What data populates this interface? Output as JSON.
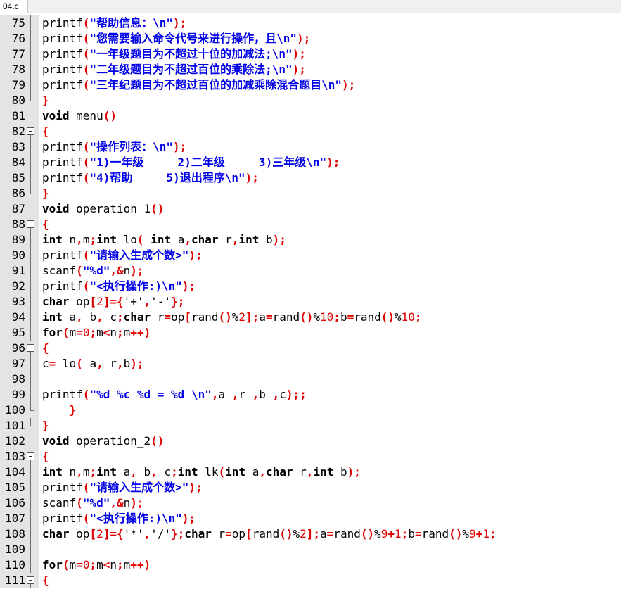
{
  "tab": {
    "label": "04.c"
  },
  "colors": {
    "keyword": "#000000",
    "string": "#0000e8",
    "operator": "#e00000",
    "number": "#e00000",
    "gutter": "#e4e4e4"
  },
  "lines": [
    {
      "n": "75",
      "fold": "line",
      "tokens": [
        [
          "plain",
          "printf"
        ],
        [
          "op",
          "("
        ],
        [
          "str",
          "\"帮助信息：\\n\""
        ],
        [
          "op",
          ");"
        ]
      ]
    },
    {
      "n": "76",
      "fold": "line",
      "tokens": [
        [
          "plain",
          "printf"
        ],
        [
          "op",
          "("
        ],
        [
          "str",
          "\"您需要输入命令代号来进行操作，且\\n\""
        ],
        [
          "op",
          ");"
        ]
      ]
    },
    {
      "n": "77",
      "fold": "line",
      "tokens": [
        [
          "plain",
          "printf"
        ],
        [
          "op",
          "("
        ],
        [
          "str",
          "\"一年级题目为不超过十位的加减法;\\n\""
        ],
        [
          "op",
          ");"
        ]
      ]
    },
    {
      "n": "78",
      "fold": "line",
      "tokens": [
        [
          "plain",
          "printf"
        ],
        [
          "op",
          "("
        ],
        [
          "str",
          "\"二年级题目为不超过百位的乘除法;\\n\""
        ],
        [
          "op",
          ");"
        ]
      ]
    },
    {
      "n": "79",
      "fold": "line",
      "tokens": [
        [
          "plain",
          "printf"
        ],
        [
          "op",
          "("
        ],
        [
          "str",
          "\"三年纪题目为不超过百位的加减乘除混合题目\\n\""
        ],
        [
          "op",
          ");"
        ]
      ]
    },
    {
      "n": "80",
      "fold": "end",
      "tokens": [
        [
          "op",
          "}"
        ]
      ]
    },
    {
      "n": "81",
      "fold": "none",
      "tokens": [
        [
          "kw",
          "void"
        ],
        [
          "plain",
          " menu"
        ],
        [
          "op",
          "()"
        ]
      ]
    },
    {
      "n": "82",
      "fold": "box",
      "tokens": [
        [
          "op",
          "{"
        ]
      ]
    },
    {
      "n": "83",
      "fold": "line",
      "tokens": [
        [
          "plain",
          "printf"
        ],
        [
          "op",
          "("
        ],
        [
          "str",
          "\"操作列表：\\n\""
        ],
        [
          "op",
          ");"
        ]
      ]
    },
    {
      "n": "84",
      "fold": "line",
      "tokens": [
        [
          "plain",
          "printf"
        ],
        [
          "op",
          "("
        ],
        [
          "str",
          "\"1)一年级     2)二年级     3)三年级\\n\""
        ],
        [
          "op",
          ");"
        ]
      ]
    },
    {
      "n": "85",
      "fold": "line",
      "tokens": [
        [
          "plain",
          "printf"
        ],
        [
          "op",
          "("
        ],
        [
          "str",
          "\"4)帮助     5)退出程序\\n\""
        ],
        [
          "op",
          ");"
        ]
      ]
    },
    {
      "n": "86",
      "fold": "end",
      "tokens": [
        [
          "op",
          "}"
        ]
      ]
    },
    {
      "n": "87",
      "fold": "none",
      "tokens": [
        [
          "kw",
          "void"
        ],
        [
          "plain",
          " operation_1"
        ],
        [
          "op",
          "()"
        ]
      ]
    },
    {
      "n": "88",
      "fold": "box",
      "tokens": [
        [
          "op",
          "{"
        ]
      ]
    },
    {
      "n": "89",
      "fold": "line",
      "tokens": [
        [
          "kw",
          "int"
        ],
        [
          "plain",
          " n"
        ],
        [
          "op",
          ","
        ],
        [
          "plain",
          "m"
        ],
        [
          "op",
          ";"
        ],
        [
          "kw",
          "int"
        ],
        [
          "plain",
          " lo"
        ],
        [
          "op",
          "("
        ],
        [
          "plain",
          " "
        ],
        [
          "kw",
          "int"
        ],
        [
          "plain",
          " a"
        ],
        [
          "op",
          ","
        ],
        [
          "kw",
          "char"
        ],
        [
          "plain",
          " r"
        ],
        [
          "op",
          ","
        ],
        [
          "kw",
          "int"
        ],
        [
          "plain",
          " b"
        ],
        [
          "op",
          ");"
        ]
      ]
    },
    {
      "n": "90",
      "fold": "line",
      "tokens": [
        [
          "plain",
          "printf"
        ],
        [
          "op",
          "("
        ],
        [
          "str",
          "\"请输入生成个数>\""
        ],
        [
          "op",
          ");"
        ]
      ]
    },
    {
      "n": "91",
      "fold": "line",
      "tokens": [
        [
          "plain",
          "scanf"
        ],
        [
          "op",
          "("
        ],
        [
          "str",
          "\"%d\""
        ],
        [
          "op",
          ",&"
        ],
        [
          "plain",
          "n"
        ],
        [
          "op",
          ");"
        ]
      ]
    },
    {
      "n": "92",
      "fold": "line",
      "tokens": [
        [
          "plain",
          "printf"
        ],
        [
          "op",
          "("
        ],
        [
          "str",
          "\"<执行操作:)\\n\""
        ],
        [
          "op",
          ");"
        ]
      ]
    },
    {
      "n": "93",
      "fold": "line",
      "tokens": [
        [
          "kw",
          "char"
        ],
        [
          "plain",
          " op"
        ],
        [
          "op",
          "["
        ],
        [
          "num",
          "2"
        ],
        [
          "op",
          "]={"
        ],
        [
          "plain",
          "'+'"
        ],
        [
          "op",
          ","
        ],
        [
          "plain",
          "'-'"
        ],
        [
          "op",
          "};"
        ]
      ]
    },
    {
      "n": "94",
      "fold": "line",
      "tokens": [
        [
          "kw",
          "int"
        ],
        [
          "plain",
          " a"
        ],
        [
          "op",
          ","
        ],
        [
          "plain",
          " b"
        ],
        [
          "op",
          ","
        ],
        [
          "plain",
          " c"
        ],
        [
          "op",
          ";"
        ],
        [
          "kw",
          "char"
        ],
        [
          "plain",
          " r"
        ],
        [
          "op",
          "="
        ],
        [
          "plain",
          "op"
        ],
        [
          "op",
          "["
        ],
        [
          "plain",
          "rand"
        ],
        [
          "op",
          "()"
        ],
        [
          "plain",
          "%"
        ],
        [
          "num",
          "2"
        ],
        [
          "op",
          "];"
        ],
        [
          "plain",
          "a"
        ],
        [
          "op",
          "="
        ],
        [
          "plain",
          "rand"
        ],
        [
          "op",
          "()"
        ],
        [
          "plain",
          "%"
        ],
        [
          "num",
          "10"
        ],
        [
          "op",
          ";"
        ],
        [
          "plain",
          "b"
        ],
        [
          "op",
          "="
        ],
        [
          "plain",
          "rand"
        ],
        [
          "op",
          "()"
        ],
        [
          "plain",
          "%"
        ],
        [
          "num",
          "10"
        ],
        [
          "op",
          ";"
        ]
      ]
    },
    {
      "n": "95",
      "fold": "line",
      "tokens": [
        [
          "kw",
          "for"
        ],
        [
          "op",
          "("
        ],
        [
          "plain",
          "m"
        ],
        [
          "op",
          "="
        ],
        [
          "num",
          "0"
        ],
        [
          "op",
          ";"
        ],
        [
          "plain",
          "m"
        ],
        [
          "op",
          "<"
        ],
        [
          "plain",
          "n"
        ],
        [
          "op",
          ";"
        ],
        [
          "plain",
          "m"
        ],
        [
          "op",
          "++)"
        ]
      ]
    },
    {
      "n": "96",
      "fold": "box",
      "tokens": [
        [
          "op",
          "{"
        ]
      ]
    },
    {
      "n": "97",
      "fold": "line",
      "tokens": [
        [
          "plain",
          "c"
        ],
        [
          "op",
          "="
        ],
        [
          "plain",
          " lo"
        ],
        [
          "op",
          "("
        ],
        [
          "plain",
          " a"
        ],
        [
          "op",
          ","
        ],
        [
          "plain",
          " r"
        ],
        [
          "op",
          ","
        ],
        [
          "plain",
          "b"
        ],
        [
          "op",
          ");"
        ]
      ]
    },
    {
      "n": "98",
      "fold": "line",
      "tokens": []
    },
    {
      "n": "99",
      "fold": "line",
      "tokens": [
        [
          "plain",
          "printf"
        ],
        [
          "op",
          "("
        ],
        [
          "str",
          "\"%d %c %d = %d \\n\""
        ],
        [
          "op",
          ","
        ],
        [
          "plain",
          "a "
        ],
        [
          "op",
          ","
        ],
        [
          "plain",
          "r "
        ],
        [
          "op",
          ","
        ],
        [
          "plain",
          "b "
        ],
        [
          "op",
          ","
        ],
        [
          "plain",
          "c"
        ],
        [
          "op",
          ");;"
        ]
      ]
    },
    {
      "n": "100",
      "fold": "end",
      "tokens": [
        [
          "plain",
          "    "
        ],
        [
          "op",
          "}"
        ]
      ]
    },
    {
      "n": "101",
      "fold": "end",
      "tokens": [
        [
          "op",
          "}"
        ]
      ]
    },
    {
      "n": "102",
      "fold": "none",
      "tokens": [
        [
          "kw",
          "void"
        ],
        [
          "plain",
          " operation_2"
        ],
        [
          "op",
          "()"
        ]
      ]
    },
    {
      "n": "103",
      "fold": "box",
      "tokens": [
        [
          "op",
          "{"
        ]
      ]
    },
    {
      "n": "104",
      "fold": "line",
      "tokens": [
        [
          "kw",
          "int"
        ],
        [
          "plain",
          " n"
        ],
        [
          "op",
          ","
        ],
        [
          "plain",
          "m"
        ],
        [
          "op",
          ";"
        ],
        [
          "kw",
          "int"
        ],
        [
          "plain",
          " a"
        ],
        [
          "op",
          ","
        ],
        [
          "plain",
          " b"
        ],
        [
          "op",
          ","
        ],
        [
          "plain",
          " c"
        ],
        [
          "op",
          ";"
        ],
        [
          "kw",
          "int"
        ],
        [
          "plain",
          " lk"
        ],
        [
          "op",
          "("
        ],
        [
          "kw",
          "int"
        ],
        [
          "plain",
          " a"
        ],
        [
          "op",
          ","
        ],
        [
          "kw",
          "char"
        ],
        [
          "plain",
          " r"
        ],
        [
          "op",
          ","
        ],
        [
          "kw",
          "int"
        ],
        [
          "plain",
          " b"
        ],
        [
          "op",
          ");"
        ]
      ]
    },
    {
      "n": "105",
      "fold": "line",
      "tokens": [
        [
          "plain",
          "printf"
        ],
        [
          "op",
          "("
        ],
        [
          "str",
          "\"请输入生成个数>\""
        ],
        [
          "op",
          ");"
        ]
      ]
    },
    {
      "n": "106",
      "fold": "line",
      "tokens": [
        [
          "plain",
          "scanf"
        ],
        [
          "op",
          "("
        ],
        [
          "str",
          "\"%d\""
        ],
        [
          "op",
          ",&"
        ],
        [
          "plain",
          "n"
        ],
        [
          "op",
          ");"
        ]
      ]
    },
    {
      "n": "107",
      "fold": "line",
      "tokens": [
        [
          "plain",
          "printf"
        ],
        [
          "op",
          "("
        ],
        [
          "str",
          "\"<执行操作:)\\n\""
        ],
        [
          "op",
          ");"
        ]
      ]
    },
    {
      "n": "108",
      "fold": "line",
      "tokens": [
        [
          "kw",
          "char"
        ],
        [
          "plain",
          " op"
        ],
        [
          "op",
          "["
        ],
        [
          "num",
          "2"
        ],
        [
          "op",
          "]={"
        ],
        [
          "plain",
          "'*'"
        ],
        [
          "op",
          ","
        ],
        [
          "plain",
          "'/'"
        ],
        [
          "op",
          "};"
        ],
        [
          "kw",
          "char"
        ],
        [
          "plain",
          " r"
        ],
        [
          "op",
          "="
        ],
        [
          "plain",
          "op"
        ],
        [
          "op",
          "["
        ],
        [
          "plain",
          "rand"
        ],
        [
          "op",
          "()"
        ],
        [
          "plain",
          "%"
        ],
        [
          "num",
          "2"
        ],
        [
          "op",
          "];"
        ],
        [
          "plain",
          "a"
        ],
        [
          "op",
          "="
        ],
        [
          "plain",
          "rand"
        ],
        [
          "op",
          "()"
        ],
        [
          "plain",
          "%"
        ],
        [
          "num",
          "9"
        ],
        [
          "op",
          "+"
        ],
        [
          "num",
          "1"
        ],
        [
          "op",
          ";"
        ],
        [
          "plain",
          "b"
        ],
        [
          "op",
          "="
        ],
        [
          "plain",
          "rand"
        ],
        [
          "op",
          "()"
        ],
        [
          "plain",
          "%"
        ],
        [
          "num",
          "9"
        ],
        [
          "op",
          "+"
        ],
        [
          "num",
          "1"
        ],
        [
          "op",
          ";"
        ]
      ]
    },
    {
      "n": "109",
      "fold": "line",
      "tokens": []
    },
    {
      "n": "110",
      "fold": "line",
      "tokens": [
        [
          "kw",
          "for"
        ],
        [
          "op",
          "("
        ],
        [
          "plain",
          "m"
        ],
        [
          "op",
          "="
        ],
        [
          "num",
          "0"
        ],
        [
          "op",
          ";"
        ],
        [
          "plain",
          "m"
        ],
        [
          "op",
          "<"
        ],
        [
          "plain",
          "n"
        ],
        [
          "op",
          ";"
        ],
        [
          "plain",
          "m"
        ],
        [
          "op",
          "++)"
        ]
      ]
    },
    {
      "n": "111",
      "fold": "box",
      "tokens": [
        [
          "op",
          "{"
        ]
      ]
    }
  ]
}
